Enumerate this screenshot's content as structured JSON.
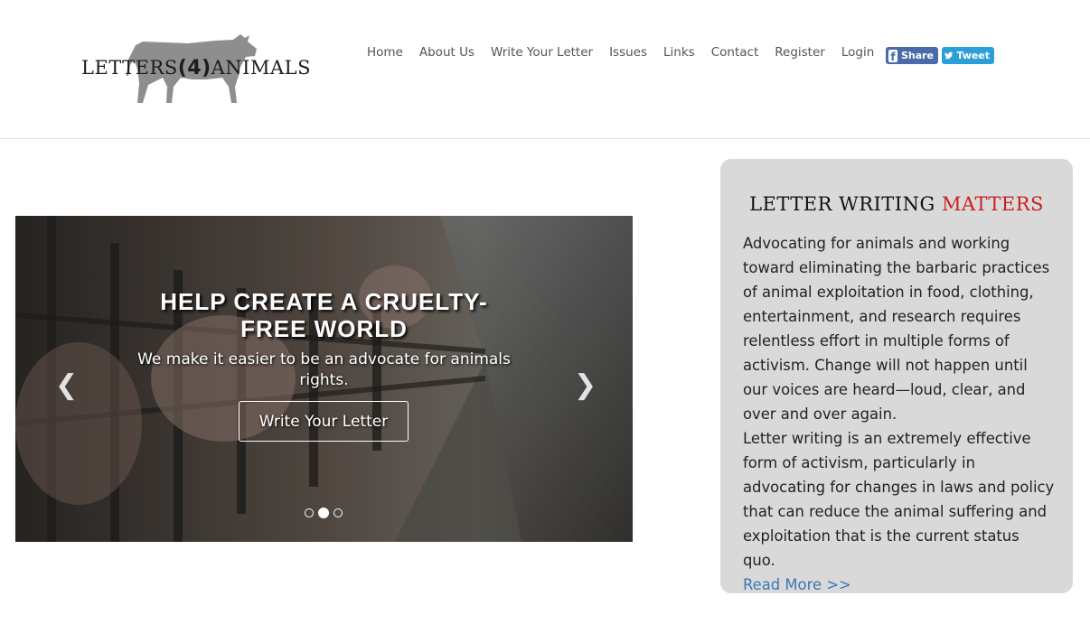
{
  "brand": {
    "logo_text_left": "LETTERS",
    "logo_text_num": "(4)",
    "logo_text_right": "ANIMALS"
  },
  "nav": {
    "items": [
      "Home",
      "About Us",
      "Write Your Letter",
      "Issues",
      "Links",
      "Contact",
      "Register",
      "Login"
    ]
  },
  "social": {
    "share_label": "Share",
    "tweet_label": "Tweet"
  },
  "carousel": {
    "heading": "HELP CREATE A CRUELTY-FREE WORLD",
    "subtext": "We make it easier to be an advocate for animals rights.",
    "cta_label": "Write Your Letter",
    "prev_glyph": "❮",
    "next_glyph": "❯",
    "slide_count": 3,
    "active_slide": 2
  },
  "sidebar": {
    "title_plain": "LETTER WRITING",
    "title_highlight": "MATTERS",
    "highlight_color": "#cc1f1f",
    "paragraph1": "Advocating for animals and working toward eliminating the barbaric practices of animal exploitation in food, clothing, entertainment, and research requires relentless effort in multiple forms of activism. Change will not happen until our voices are heard—loud, clear, and over and over again.",
    "paragraph2": "Letter writing is an extremely effective form of activism, particularly in advocating for changes in laws and policy that can reduce the animal suffering and exploitation that is the current status quo.",
    "read_more": "Read More >>"
  },
  "colors": {
    "link": "#3a78b5",
    "facebook": "#4a6aa9",
    "twitter": "#2c9fd8",
    "card_bg": "#d9d9d9"
  }
}
